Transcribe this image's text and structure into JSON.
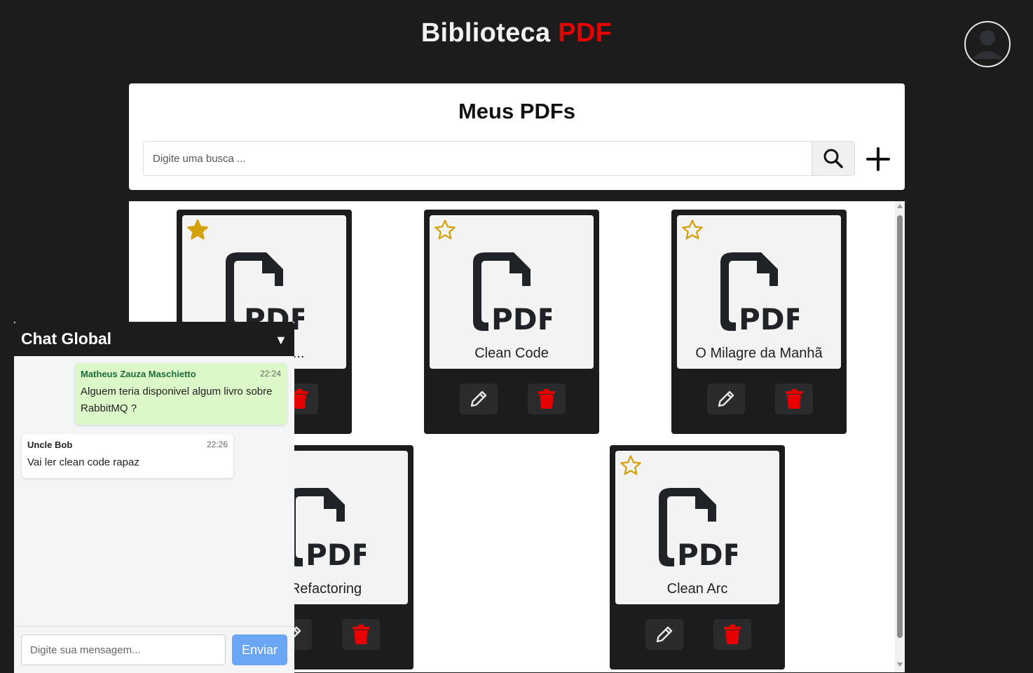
{
  "header": {
    "title_main": "Biblioteca",
    "title_accent": "PDF",
    "accent_color": "#e60000"
  },
  "panel": {
    "title": "Meus PDFs",
    "search_placeholder": "Digite uma busca ...",
    "search_icon": "search-icon",
    "add_icon": "plus-icon"
  },
  "cards": [
    {
      "title": "Clean Code",
      "favorite": false
    },
    {
      "title": "O Milagre da Manhã",
      "favorite": false
    },
    {
      "title": "Refactoring",
      "favorite": false
    },
    {
      "title": "Clean Arc",
      "favorite": false
    }
  ],
  "hidden_card_title_fragment": "s do...",
  "icons": {
    "star_color": "#d4a10a",
    "delete_color": "#e60000",
    "file": "file-pdf-icon",
    "edit": "pencil-icon",
    "delete": "trash-icon"
  },
  "chat": {
    "title": "Chat Global",
    "toggle_icon": "▼",
    "messages": [
      {
        "author": "Matheus Zauza Maschietto",
        "time": "22:24",
        "text": "Alguem teria disponivel algum livro sobre RabbitMQ ?"
      },
      {
        "author": "Uncle Bob",
        "time": "22:26",
        "text": "Vai ler clean code rapaz"
      }
    ],
    "input_placeholder": "Digite sua mensagem...",
    "send_label": "Enviar"
  }
}
